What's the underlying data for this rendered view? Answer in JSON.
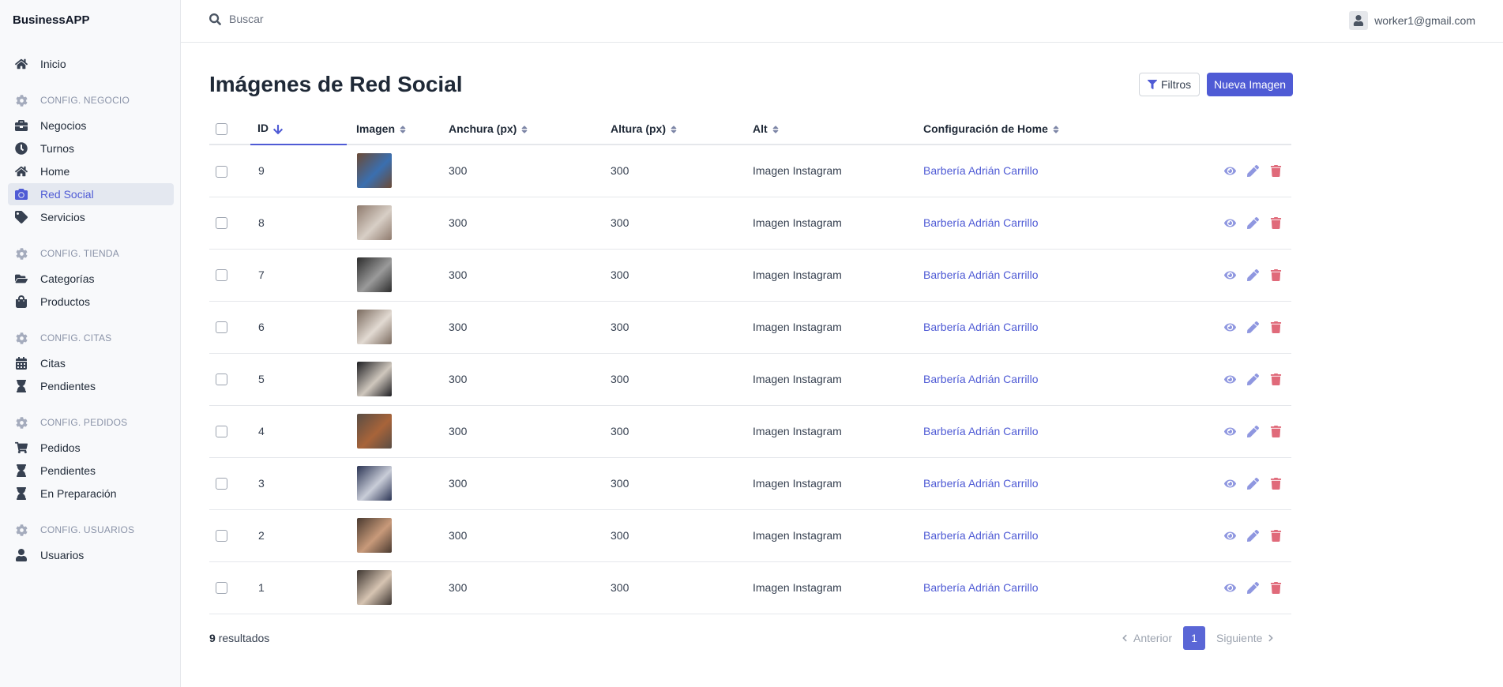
{
  "app": {
    "brand": "BusinessAPP"
  },
  "sidebar": {
    "top": [
      {
        "label": "Inicio",
        "icon": "home-icon"
      }
    ],
    "sections": [
      {
        "title": "CONFIG. NEGOCIO",
        "items": [
          {
            "label": "Negocios",
            "icon": "briefcase-icon",
            "active": false
          },
          {
            "label": "Turnos",
            "icon": "clock-icon",
            "active": false
          },
          {
            "label": "Home",
            "icon": "home-icon",
            "active": false
          },
          {
            "label": "Red Social",
            "icon": "camera-icon",
            "active": true
          },
          {
            "label": "Servicios",
            "icon": "tag-icon",
            "active": false
          }
        ]
      },
      {
        "title": "CONFIG. TIENDA",
        "items": [
          {
            "label": "Categorías",
            "icon": "folder-open-icon",
            "active": false
          },
          {
            "label": "Productos",
            "icon": "shopping-bag-icon",
            "active": false
          }
        ]
      },
      {
        "title": "CONFIG. CITAS",
        "items": [
          {
            "label": "Citas",
            "icon": "calendar-icon",
            "active": false
          },
          {
            "label": "Pendientes",
            "icon": "hourglass-icon",
            "active": false
          }
        ]
      },
      {
        "title": "CONFIG. PEDIDOS",
        "items": [
          {
            "label": "Pedidos",
            "icon": "cart-icon",
            "active": false
          },
          {
            "label": "Pendientes",
            "icon": "hourglass-icon",
            "active": false
          },
          {
            "label": "En Preparación",
            "icon": "hourglass-icon",
            "active": false
          }
        ]
      },
      {
        "title": "CONFIG. USUARIOS",
        "items": [
          {
            "label": "Usuarios",
            "icon": "user-icon",
            "active": false
          }
        ]
      }
    ]
  },
  "topbar": {
    "search_placeholder": "Buscar",
    "user_email": "worker1@gmail.com"
  },
  "page": {
    "title": "Imágenes de Red Social",
    "filter_label": "Filtros",
    "new_label": "Nueva Imagen"
  },
  "table": {
    "columns": [
      "ID",
      "Imagen",
      "Anchura (px)",
      "Altura (px)",
      "Alt",
      "Configuración de Home"
    ],
    "rows": [
      {
        "id": "9",
        "width": "300",
        "height": "300",
        "alt": "Imagen Instagram",
        "home": "Barbería Adrián Carrillo",
        "thumb_colors": [
          "#6b4a35",
          "#3a6fb0"
        ]
      },
      {
        "id": "8",
        "width": "300",
        "height": "300",
        "alt": "Imagen Instagram",
        "home": "Barbería Adrián Carrillo",
        "thumb_colors": [
          "#8f7b6e",
          "#d8cfc6"
        ]
      },
      {
        "id": "7",
        "width": "300",
        "height": "300",
        "alt": "Imagen Instagram",
        "home": "Barbería Adrián Carrillo",
        "thumb_colors": [
          "#2c2c2c",
          "#9a9a9a"
        ]
      },
      {
        "id": "6",
        "width": "300",
        "height": "300",
        "alt": "Imagen Instagram",
        "home": "Barbería Adrián Carrillo",
        "thumb_colors": [
          "#7a6a5e",
          "#e2dad2"
        ]
      },
      {
        "id": "5",
        "width": "300",
        "height": "300",
        "alt": "Imagen Instagram",
        "home": "Barbería Adrián Carrillo",
        "thumb_colors": [
          "#1e1e22",
          "#cfc7bd"
        ]
      },
      {
        "id": "4",
        "width": "300",
        "height": "300",
        "alt": "Imagen Instagram",
        "home": "Barbería Adrián Carrillo",
        "thumb_colors": [
          "#5a4d44",
          "#a8643a"
        ]
      },
      {
        "id": "3",
        "width": "300",
        "height": "300",
        "alt": "Imagen Instagram",
        "home": "Barbería Adrián Carrillo",
        "thumb_colors": [
          "#2b3454",
          "#c9cdd8"
        ]
      },
      {
        "id": "2",
        "width": "300",
        "height": "300",
        "alt": "Imagen Instagram",
        "home": "Barbería Adrián Carrillo",
        "thumb_colors": [
          "#4a3a30",
          "#c89a7a"
        ]
      },
      {
        "id": "1",
        "width": "300",
        "height": "300",
        "alt": "Imagen Instagram",
        "home": "Barbería Adrián Carrillo",
        "thumb_colors": [
          "#3d3530",
          "#d6c4b2"
        ]
      }
    ]
  },
  "footer": {
    "results_count": "9",
    "results_label": "resultados",
    "prev_label": "Anterior",
    "next_label": "Siguiente",
    "current_page": "1"
  },
  "colors": {
    "accent": "#4f5bd5",
    "danger": "#e06a7a",
    "view": "#8f97e0"
  }
}
